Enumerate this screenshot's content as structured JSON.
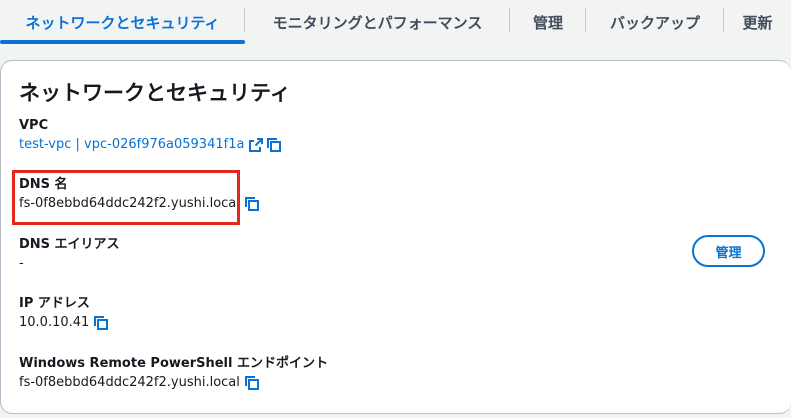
{
  "tabs": [
    {
      "label": "ネットワークとセキュリティ",
      "active": true
    },
    {
      "label": "モニタリングとパフォーマンス",
      "active": false
    },
    {
      "label": "管理",
      "active": false
    },
    {
      "label": "バックアップ",
      "active": false
    },
    {
      "label": "更新",
      "active": false
    }
  ],
  "panel": {
    "title": "ネットワークとセキュリティ",
    "vpc": {
      "label": "VPC",
      "value": "test-vpc | vpc-026f976a059341f1a"
    },
    "dns_name": {
      "label": "DNS 名",
      "value": "fs-0f8ebbd64ddc242f2.yushi.local"
    },
    "dns_alias": {
      "label": "DNS エイリアス",
      "value": "-"
    },
    "ip_address": {
      "label": "IP アドレス",
      "value": "10.0.10.41"
    },
    "powershell_endpoint": {
      "label": "Windows Remote PowerShell エンドポイント",
      "value": "fs-0f8ebbd64ddc242f2.yushi.local"
    },
    "manage_button": "管理"
  },
  "colors": {
    "accent": "#0972d3",
    "highlight": "#e2271b",
    "text": "#16191f"
  },
  "icons": [
    "external-link-icon",
    "copy-icon"
  ]
}
